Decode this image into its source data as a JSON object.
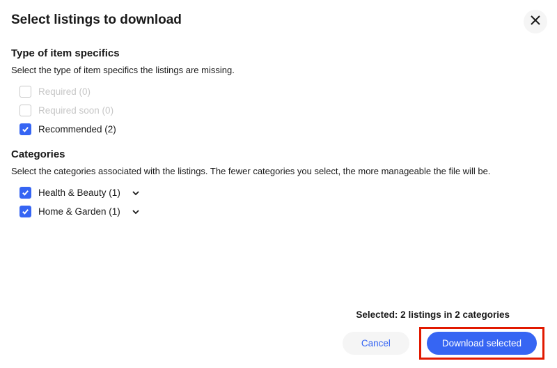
{
  "title": "Select listings to download",
  "sections": {
    "type": {
      "heading": "Type of item specifics",
      "desc": "Select the type of item specifics the listings are missing.",
      "options": [
        {
          "label": "Required (0)"
        },
        {
          "label": "Required soon (0)"
        },
        {
          "label": "Recommended (2)"
        }
      ]
    },
    "categories": {
      "heading": "Categories",
      "desc": "Select the categories associated with the listings. The fewer categories you select, the more manageable the file will be.",
      "options": [
        {
          "label": "Health & Beauty (1)"
        },
        {
          "label": "Home & Garden (1)"
        }
      ]
    }
  },
  "footer": {
    "selected": "Selected: 2 listings in 2 categories",
    "cancel": "Cancel",
    "download": "Download selected"
  }
}
